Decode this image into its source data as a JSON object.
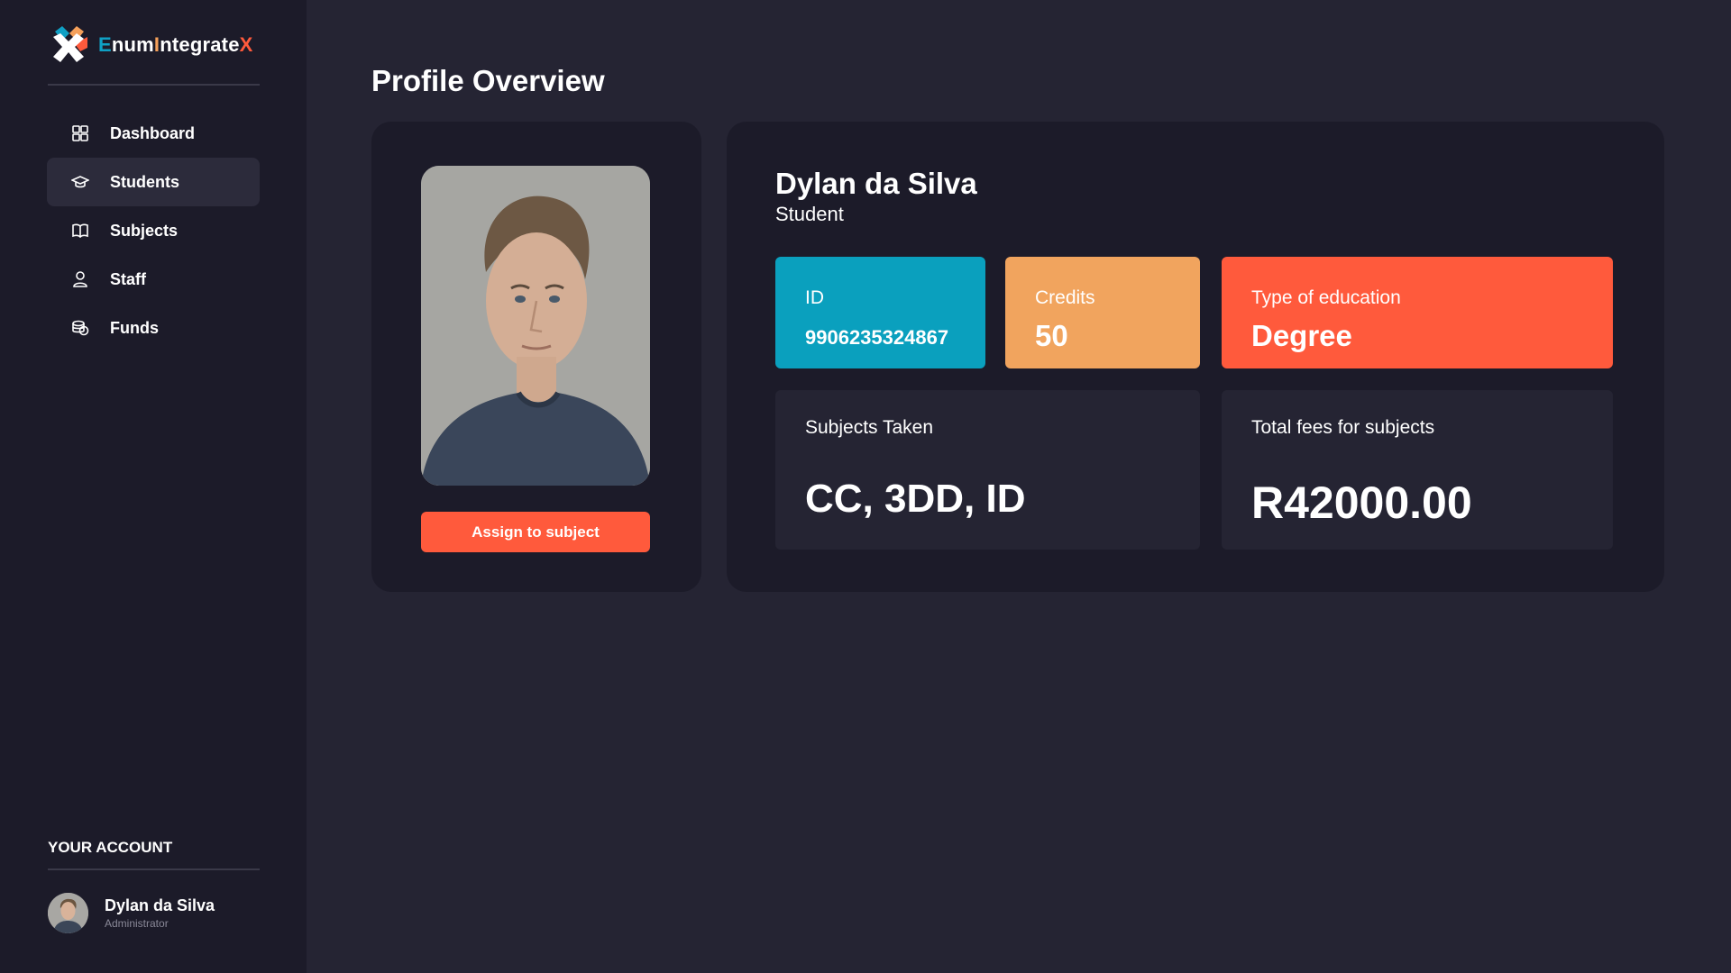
{
  "brand": {
    "parts": [
      "E",
      "num",
      "I",
      "ntegrate",
      "X"
    ]
  },
  "sidebar": {
    "items": [
      {
        "label": "Dashboard",
        "icon": "grid-icon",
        "active": false
      },
      {
        "label": "Students",
        "icon": "graduation-cap-icon",
        "active": true
      },
      {
        "label": "Subjects",
        "icon": "book-icon",
        "active": false
      },
      {
        "label": "Staff",
        "icon": "user-icon",
        "active": false
      },
      {
        "label": "Funds",
        "icon": "coins-icon",
        "active": false
      }
    ],
    "account_heading": "YOUR ACCOUNT",
    "account": {
      "name": "Dylan da Silva",
      "role": "Administrator"
    }
  },
  "main": {
    "title": "Profile Overview",
    "assign_button": "Assign to subject",
    "profile": {
      "name": "Dylan da Silva",
      "role": "Student"
    },
    "tiles": {
      "id": {
        "label": "ID",
        "value": "9906235324867"
      },
      "credits": {
        "label": "Credits",
        "value": "50"
      },
      "type": {
        "label": "Type of education",
        "value": "Degree"
      },
      "subjects": {
        "label": "Subjects Taken",
        "value": "CC, 3DD, ID"
      },
      "fees": {
        "label": "Total fees for subjects",
        "value": "R42000.00"
      }
    }
  },
  "colors": {
    "sidebar_bg": "#1c1b29",
    "page_bg": "#252433",
    "accent_teal": "#0aa0be",
    "accent_amber": "#f1a45e",
    "accent_orange": "#ff5a3c"
  }
}
